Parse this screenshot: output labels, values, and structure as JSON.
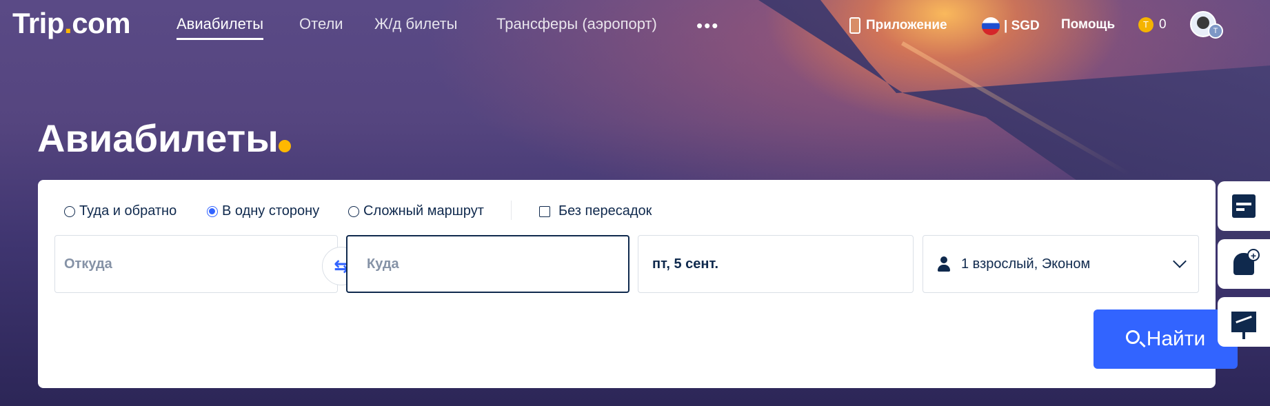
{
  "header": {
    "logo_text": "Trip",
    "logo_dot": ".",
    "logo_suffix": "com",
    "nav": [
      {
        "label": "Авиабилеты",
        "active": true
      },
      {
        "label": "Отели"
      },
      {
        "label": "Ж/д билеты"
      },
      {
        "label": "Трансферы (аэропорт)"
      }
    ],
    "more_label": "•••",
    "app_label": "Приложение",
    "currency_label": "| SGD",
    "help_label": "Помощь",
    "coins_count": "0",
    "coin_symbol": "T",
    "avatar_badge": "T"
  },
  "hero": {
    "title": "Авиабилеты",
    "accent_color": "#ffb800"
  },
  "search": {
    "trip_types": [
      {
        "label": "Туда и обратно",
        "selected": false
      },
      {
        "label": "В одну сторону",
        "selected": true
      },
      {
        "label": "Сложный маршрут",
        "selected": false
      }
    ],
    "nonstop_label": "Без пересадок",
    "nonstop_checked": false,
    "from_placeholder": "Откуда",
    "to_placeholder": "Куда",
    "date_value": "пт, 5 сент.",
    "passengers_value": "1 взрослый, Эконом",
    "search_button": "Найти",
    "button_color": "#3264ff"
  },
  "side_tools": [
    {
      "icon": "calendar-icon"
    },
    {
      "icon": "bell-plus-icon"
    },
    {
      "icon": "price-trend-icon"
    }
  ]
}
